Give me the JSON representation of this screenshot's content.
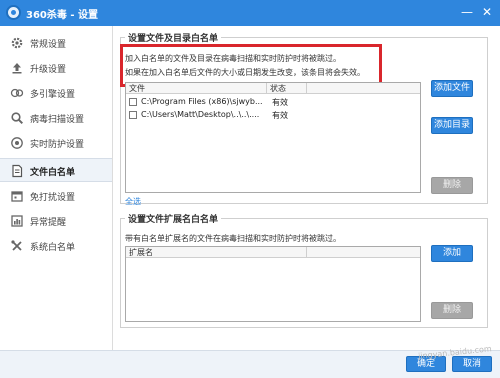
{
  "window": {
    "title": "360杀毒 - 设置",
    "minimize_glyph": "—",
    "close_glyph": "✕"
  },
  "sidebar": {
    "items": [
      {
        "label": "常规设置",
        "icon": "gear-icon",
        "active": false
      },
      {
        "label": "升级设置",
        "icon": "upload-icon",
        "active": false
      },
      {
        "label": "多引擎设置",
        "icon": "engines-icon",
        "active": false
      },
      {
        "label": "病毒扫描设置",
        "icon": "magnifier-icon",
        "active": false
      },
      {
        "label": "实时防护设置",
        "icon": "shield-eye-icon",
        "active": false
      },
      {
        "label": "文件白名单",
        "icon": "document-icon",
        "active": true
      },
      {
        "label": "免打扰设置",
        "icon": "calendar-icon",
        "active": false
      },
      {
        "label": "异常提醒",
        "icon": "chart-icon",
        "active": false
      },
      {
        "label": "系统白名单",
        "icon": "tools-icon",
        "active": false
      }
    ]
  },
  "file_whitelist": {
    "title": "设置文件及目录白名单",
    "desc_line1": "加入白名单的文件及目录在病毒扫描和实时防护时将被跳过。",
    "desc_line2": "如果在加入白名单后文件的大小或日期发生改变，该条目将会失效。",
    "columns": [
      "文件",
      "状态"
    ],
    "rows": [
      {
        "file": "C:\\Program Files (x86)\\sjwyb...",
        "status": "有效"
      },
      {
        "file": "C:\\Users\\Matt\\Desktop\\..\\..\\....",
        "status": "有效"
      }
    ],
    "add_file_label": "添加文件",
    "add_dir_label": "添加目录",
    "delete_label": "删除",
    "select_all_label": "全选"
  },
  "ext_whitelist": {
    "title": "设置文件扩展名白名单",
    "desc": "带有白名单扩展名的文件在病毒扫描和实时防护时将被跳过。",
    "column": "扩展名",
    "add_label": "添加",
    "delete_label": "删除"
  },
  "footer": {
    "ok_label": "确定",
    "cancel_label": "取消"
  },
  "watermark": "jingyan.baidu.com",
  "colors": {
    "accent": "#2f86dd",
    "highlight_box": "#d9262c",
    "disabled": "#a7a7a7"
  }
}
